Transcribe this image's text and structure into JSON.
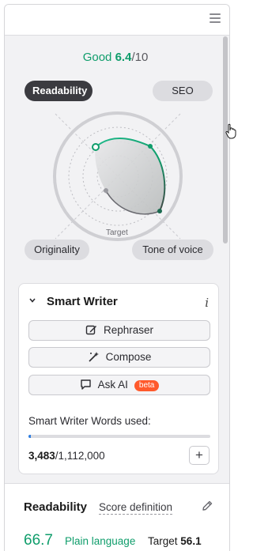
{
  "header": {
    "menu_icon": "hamburger-menu-icon"
  },
  "overall": {
    "label": "Good",
    "value": "6.4",
    "max": "/10"
  },
  "radar": {
    "axes": {
      "top_left": "Readability",
      "top_right": "SEO",
      "bottom_left": "Originality",
      "bottom_right": "Tone of voice"
    },
    "target_label": "Target",
    "colors": {
      "accent": "#0f9d6b",
      "dark_pill": "#3b3b40"
    }
  },
  "smart_writer": {
    "title": "Smart Writer",
    "info_icon": "info-icon",
    "buttons": [
      {
        "label": "Rephraser",
        "icon": "edit-icon"
      },
      {
        "label": "Compose",
        "icon": "compose-wand-icon"
      },
      {
        "label": "Ask AI",
        "icon": "chat-bubble-icon",
        "badge": "beta"
      }
    ],
    "words_label": "Smart Writer Words used:",
    "words_used": "3,483",
    "words_total": "/1,112,000",
    "usage_fraction": 0.0031,
    "add_label": "+"
  },
  "readability": {
    "title": "Readability",
    "link": "Score definition",
    "score": "66.7",
    "grade": "Plain language",
    "target_label": "Target",
    "target_value": "56.1"
  }
}
